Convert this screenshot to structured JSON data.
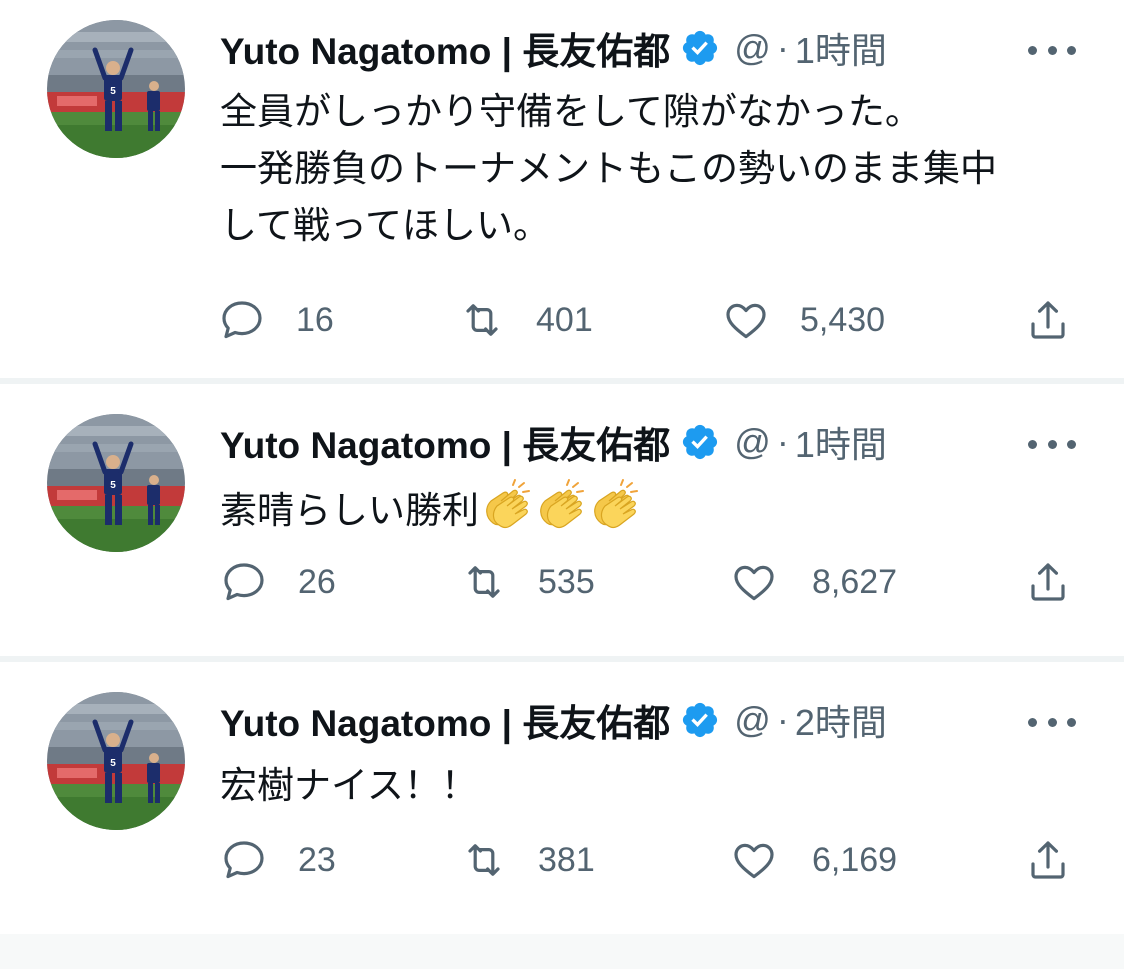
{
  "colors": {
    "text_primary": "#0f1419",
    "text_secondary": "#536471",
    "verified_blue": "#1d9bf0",
    "divider": "#eff3f4"
  },
  "icons": {
    "reply": "speech-bubble-icon",
    "retweet": "retweet-arrows-icon",
    "like": "heart-icon",
    "share": "share-upload-icon",
    "more": "more-horizontal-icon",
    "verified": "verified-badge-icon",
    "clap": "clapping-hands-emoji"
  },
  "tweets": [
    {
      "author_name": "Yuto Nagatomo | 長友佑都",
      "handle": "@",
      "dot": "·",
      "time": "1時間",
      "lines": [
        "全員がしっかり守備をして隙がなかった。",
        "一発勝負のトーナメントもこの勢いのまま集中",
        "して戦ってほしい。"
      ],
      "replies": "16",
      "retweets": "401",
      "likes": "5,430"
    },
    {
      "author_name": "Yuto Nagatomo | 長友佑都",
      "handle": "@",
      "dot": "·",
      "time": "1時間",
      "lines": [
        "素晴らしい勝利"
      ],
      "emoji": "👏👏👏",
      "replies": "26",
      "retweets": "535",
      "likes": "8,627"
    },
    {
      "author_name": "Yuto Nagatomo | 長友佑都",
      "handle": "@",
      "dot": "·",
      "time": "2時間",
      "lines": [
        "宏樹ナイス！！"
      ],
      "replies": "23",
      "retweets": "381",
      "likes": "6,169"
    }
  ]
}
